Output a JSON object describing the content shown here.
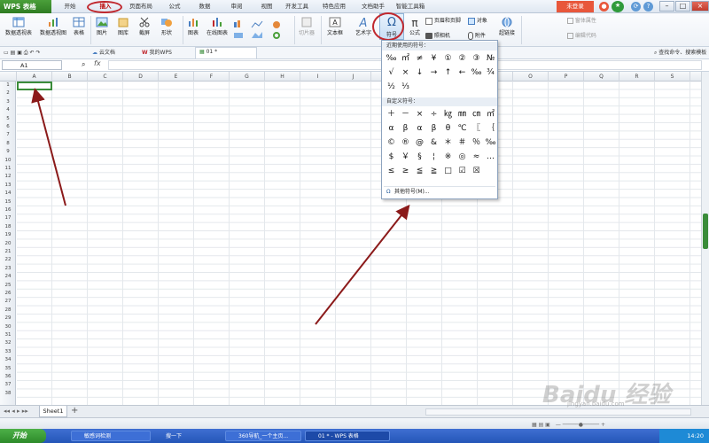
{
  "app": {
    "logo": "WPS 表格",
    "login": "未登录"
  },
  "tabs": [
    "开始",
    "插入",
    "页面布局",
    "公式",
    "数据",
    "审阅",
    "视图",
    "开发工具",
    "特色应用",
    "文档助手",
    "智能工具箱"
  ],
  "ribbon": {
    "pivot_table": "数据透视表",
    "pivot_chart": "数据透视图",
    "table": "表格",
    "picture": "图片",
    "gallery": "图库",
    "screenshot": "截屏",
    "shapes": "形状",
    "chart": "图表",
    "online_chart": "在线图表",
    "slicer": "切片器",
    "textbox": "文本框",
    "wordart": "艺术字",
    "symbol": "符号",
    "formula": "公式",
    "header_footer": "页眉和页脚",
    "object": "对象",
    "camera": "照相机",
    "attachment": "附件",
    "hyperlink": "超链接",
    "control_props": "窗体属性",
    "view_code": "编辑代码"
  },
  "quickbar": {
    "cloud": "云文档",
    "mywps": "我的WPS",
    "doc_tab": "01 *",
    "search": "查找命令、搜索模板"
  },
  "formula_bar": {
    "name_box": "A1",
    "fx": "fx"
  },
  "columns": [
    "A",
    "B",
    "C",
    "D",
    "E",
    "F",
    "G",
    "H",
    "I",
    "J",
    "K",
    "L",
    "M",
    "N",
    "O",
    "P",
    "Q",
    "R",
    "S"
  ],
  "rows": [
    "1",
    "2",
    "3",
    "4",
    "5",
    "6",
    "7",
    "8",
    "9",
    "10",
    "11",
    "12",
    "13",
    "14",
    "15",
    "16",
    "17",
    "18",
    "19",
    "20",
    "21",
    "22",
    "23",
    "24",
    "25",
    "26",
    "27",
    "28",
    "29",
    "30",
    "31",
    "32",
    "33",
    "34",
    "35",
    "36",
    "37",
    "38"
  ],
  "symbol_panel": {
    "recent_title": "近期使用的符号：",
    "recent": [
      "‰",
      "㎡",
      "≠",
      "¥",
      "①",
      "②",
      "③",
      "№",
      "√",
      "×",
      "↓",
      "→",
      "↑",
      "←",
      "‰",
      "¾",
      "½",
      "⅓"
    ],
    "custom_title": "自定义符号：",
    "custom": [
      "＋",
      "－",
      "×",
      "÷",
      "㎏",
      "㎜",
      "㎝",
      "㎡",
      "α",
      "β",
      "α",
      "β",
      "θ",
      "℃",
      "〖",
      "｛",
      "©",
      "®",
      "@",
      "&",
      "＊",
      "＃",
      "％",
      "‰",
      "$",
      "￥",
      "§",
      "¦",
      "※",
      "◎",
      "≈",
      "…",
      "≤",
      "≥",
      "≦",
      "≧",
      "□",
      "☑",
      "☒"
    ],
    "more": "其他符号(M)..."
  },
  "sheet_tab": "Sheet1",
  "taskbar": {
    "start": "开始",
    "items": [
      "敏感词检测",
      "搜一下",
      "360导航_一个主页...",
      "01 * - WPS 表格"
    ],
    "clock": "14:20"
  },
  "watermark": {
    "brand": "Baidu 经验",
    "url": "jingyan.baidu.com"
  },
  "annotation_color": "#8b1a1a"
}
